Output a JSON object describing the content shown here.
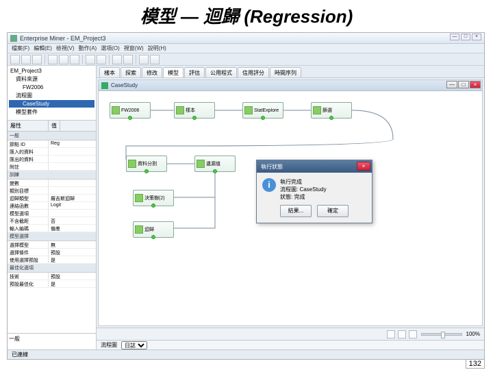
{
  "slide": {
    "title": "模型 — 迴歸 (Regression)"
  },
  "app": {
    "title": "Enterprise Miner - EM_Project3",
    "menus": [
      "檔案(F)",
      "編輯(E)",
      "檢視(V)",
      "動作(A)",
      "選項(O)",
      "視窗(W)",
      "說明(H)"
    ]
  },
  "tree": {
    "root": "EM_Project3",
    "items": [
      "資料來源",
      "FW2006",
      "流程圖",
      "CaseStudy",
      "模型套件"
    ]
  },
  "props": {
    "hdr_k": "屬性",
    "hdr_v": "值",
    "sections": [
      {
        "title": "一般",
        "rows": [
          {
            "k": "節點 ID",
            "v": "Reg"
          },
          {
            "k": "匯入的資料",
            "v": ""
          },
          {
            "k": "匯出的資料",
            "v": ""
          },
          {
            "k": "附註",
            "v": ""
          }
        ]
      },
      {
        "title": "訓練",
        "rows": [
          {
            "k": "變數",
            "v": ""
          },
          {
            "k": "類別目標",
            "v": ""
          },
          {
            "k": "迴歸類型",
            "v": "羅吉斯迴歸"
          },
          {
            "k": "連結函數",
            "v": "Logit"
          },
          {
            "k": "模型選項",
            "v": ""
          },
          {
            "k": "不含截距",
            "v": "否"
          },
          {
            "k": "輸入編碼",
            "v": "偏差"
          }
        ]
      },
      {
        "title": "模型選擇",
        "rows": [
          {
            "k": "選擇模型",
            "v": "無"
          },
          {
            "k": "選擇條件",
            "v": "預設"
          },
          {
            "k": "使用選擇預設",
            "v": "是"
          }
        ]
      },
      {
        "title": "最佳化選項",
        "rows": [
          {
            "k": "技術",
            "v": "預設"
          },
          {
            "k": "預設最佳化",
            "v": "是"
          }
        ]
      }
    ]
  },
  "tabs": [
    "樣本",
    "探索",
    "修改",
    "模型",
    "評估",
    "公用程式",
    "信用評分",
    "時間序列"
  ],
  "diagram": {
    "title": "CaseStudy",
    "nodes": {
      "n1": "FW2006",
      "n2": "樣本",
      "n3": "StatExplore",
      "n4": "篩選",
      "n5": "資料分割",
      "n6": "遺漏值",
      "n7": "決策樹(2)",
      "n8": "迴歸"
    }
  },
  "dialog": {
    "title": "執行狀態",
    "msg1": "執行完成",
    "msg2": "流程圖: CaseStudy",
    "msg3": "狀態: 完成",
    "btn_results": "結果...",
    "btn_ok": "確定"
  },
  "status_right": {
    "zoom": "100%"
  },
  "log": {
    "label": "流程圖",
    "dd": "日誌"
  },
  "statusbar": {
    "text": "已連線"
  },
  "desc": {
    "label": "一般"
  },
  "page": "132"
}
